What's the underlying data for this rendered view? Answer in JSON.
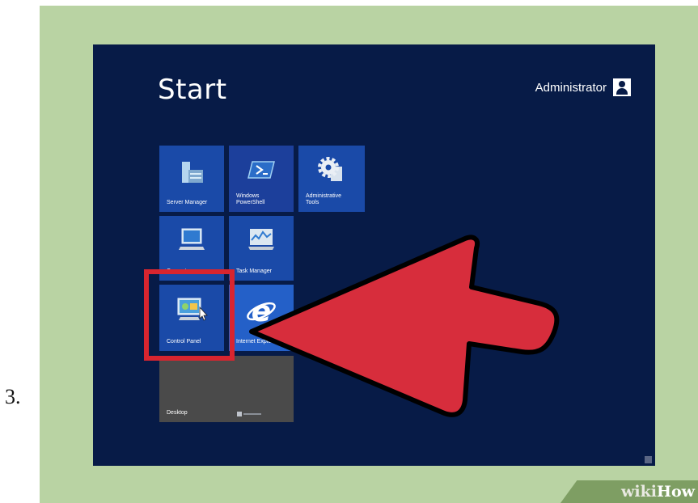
{
  "step": {
    "number": "3."
  },
  "screen": {
    "title": "Start",
    "user": {
      "name": "Administrator"
    },
    "tiles": [
      {
        "label": "Server Manager",
        "icon": "server-manager-icon"
      },
      {
        "label": "Windows PowerShell",
        "icon": "powershell-icon"
      },
      {
        "label": "Administrative Tools",
        "icon": "gear-icon"
      },
      {
        "label": "Computer",
        "icon": "computer-icon"
      },
      {
        "label": "Task Manager",
        "icon": "task-manager-icon"
      },
      {
        "label": "Control Panel",
        "icon": "control-panel-icon"
      },
      {
        "label": "Internet Explorer",
        "icon": "internet-explorer-icon"
      },
      {
        "label": "Desktop",
        "icon": "desktop-icon"
      }
    ]
  },
  "watermark": {
    "wiki": "wiki",
    "how": "How"
  },
  "colors": {
    "background": "#071b47",
    "tile": "#1a4aa8",
    "highlight": "#d8252f",
    "frame": "#b9d3a3"
  }
}
